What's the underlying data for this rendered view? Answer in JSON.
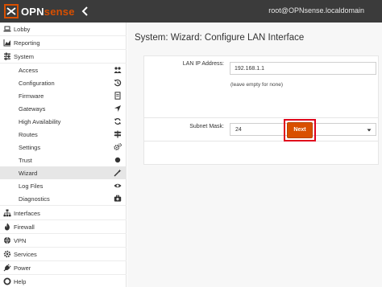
{
  "header": {
    "logo_text_a": "OPN",
    "logo_text_b": "sense",
    "user": "root@OPNsense.localdomain"
  },
  "sidebar": {
    "top_items": [
      {
        "label": "Lobby",
        "icon": "laptop-icon"
      },
      {
        "label": "Reporting",
        "icon": "area-chart-icon"
      },
      {
        "label": "System",
        "icon": "sliders-icon"
      }
    ],
    "system_sub": [
      {
        "label": "Access",
        "icon": "users-icon"
      },
      {
        "label": "Configuration",
        "icon": "history-icon"
      },
      {
        "label": "Firmware",
        "icon": "document-icon"
      },
      {
        "label": "Gateways",
        "icon": "location-arrow-icon"
      },
      {
        "label": "High Availability",
        "icon": "refresh-icon"
      },
      {
        "label": "Routes",
        "icon": "signpost-icon"
      },
      {
        "label": "Settings",
        "icon": "cogs-icon"
      },
      {
        "label": "Trust",
        "icon": "circle-icon"
      },
      {
        "label": "Wizard",
        "icon": "magic-wand-icon"
      },
      {
        "label": "Log Files",
        "icon": "eye-icon"
      },
      {
        "label": "Diagnostics",
        "icon": "medkit-icon"
      }
    ],
    "bottom_items": [
      {
        "label": "Interfaces",
        "icon": "sitemap-icon"
      },
      {
        "label": "Firewall",
        "icon": "fire-icon"
      },
      {
        "label": "VPN",
        "icon": "globe-icon"
      },
      {
        "label": "Services",
        "icon": "cog-icon"
      },
      {
        "label": "Power",
        "icon": "plug-icon"
      },
      {
        "label": "Help",
        "icon": "support-icon"
      }
    ],
    "active": "Wizard"
  },
  "main": {
    "title": "System: Wizard: Configure LAN Interface",
    "lan_ip_label": "LAN IP Address:",
    "lan_ip_value": "192.168.1.1",
    "lan_ip_hint": "(leave empty for none)",
    "subnet_label": "Subnet Mask:",
    "subnet_value": "24",
    "next_label": "Next"
  },
  "colors": {
    "topbar": "#3b3b3b",
    "accent": "#d94f00",
    "highlight": "#e0001b"
  }
}
